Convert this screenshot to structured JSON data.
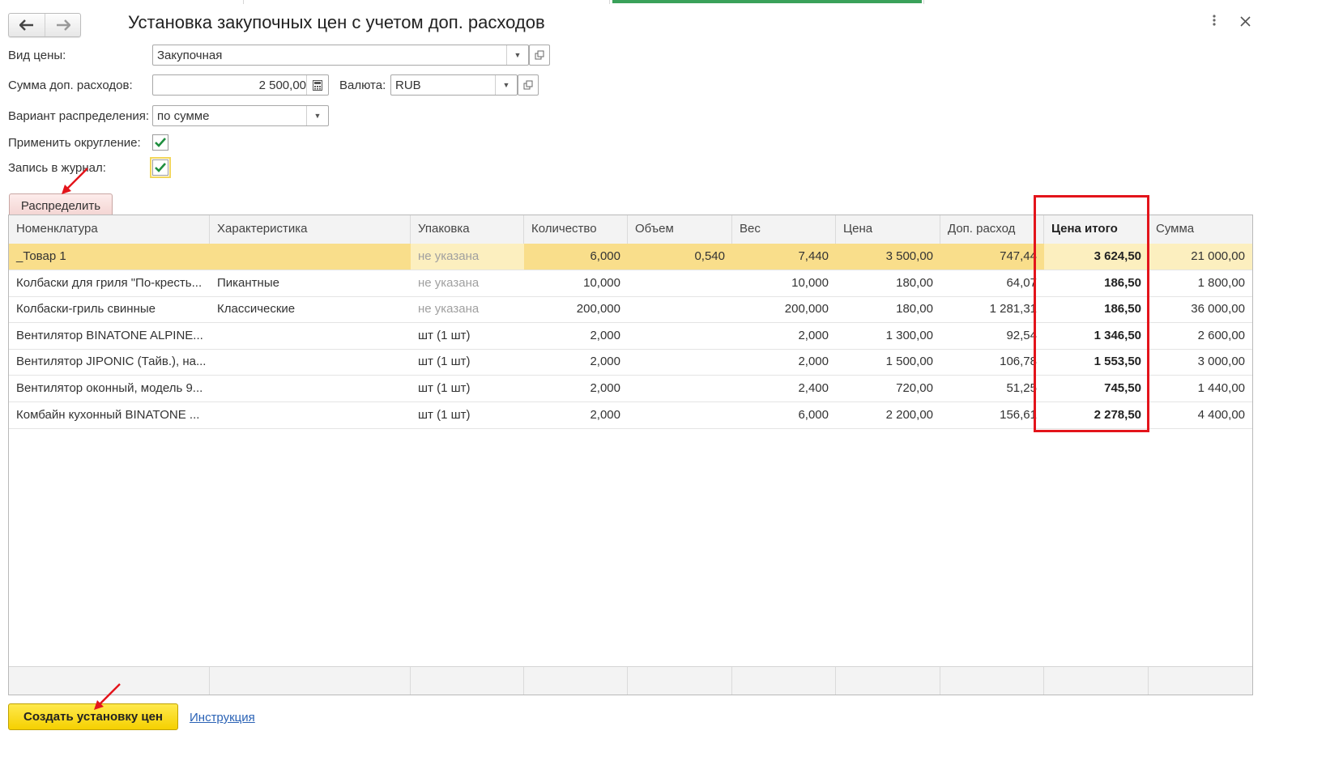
{
  "window": {
    "title": "Установка закупочных цен с учетом доп. расходов",
    "back_icon": "arrow-left",
    "forward_icon": "arrow-right",
    "more_icon": "vertical-dots",
    "close_icon": "close-x"
  },
  "form": {
    "price_type_label": "Вид цены:",
    "price_type_value": "Закупочная",
    "extra_costs_label": "Сумма доп. расходов:",
    "extra_costs_value": "2 500,00",
    "currency_label": "Валюта:",
    "currency_value": "RUB",
    "distribution_label": "Вариант распределения:",
    "distribution_value": "по сумме",
    "rounding_label": "Применить округление:",
    "rounding_checked": true,
    "journal_label": "Запись в журнал:",
    "journal_checked": true,
    "distribute_button": "Распределить"
  },
  "table": {
    "headers": [
      "Номенклатура",
      "Характеристика",
      "Упаковка",
      "Количество",
      "Объем",
      "Вес",
      "Цена",
      "Доп. расход",
      "Цена итого",
      "Сумма"
    ],
    "rows": [
      [
        "_Товар 1",
        "",
        "не указана",
        "6,000",
        "0,540",
        "7,440",
        "3 500,00",
        "747,44",
        "3 624,50",
        "21 000,00"
      ],
      [
        "Колбаски для гриля \"По-кресть...",
        "Пикантные",
        "не указана",
        "10,000",
        "",
        "10,000",
        "180,00",
        "64,07",
        "186,50",
        "1 800,00"
      ],
      [
        "Колбаски-гриль свинные",
        "Классические",
        "не указана",
        "200,000",
        "",
        "200,000",
        "180,00",
        "1 281,31",
        "186,50",
        "36 000,00"
      ],
      [
        "Вентилятор BINATONE ALPINE...",
        "",
        "шт (1 шт)",
        "2,000",
        "",
        "2,000",
        "1 300,00",
        "92,54",
        "1 346,50",
        "2 600,00"
      ],
      [
        "Вентилятор JIPONIC (Тайв.), на...",
        "",
        "шт (1 шт)",
        "2,000",
        "",
        "2,000",
        "1 500,00",
        "106,78",
        "1 553,50",
        "3 000,00"
      ],
      [
        "Вентилятор оконный, модель 9...",
        "",
        "шт (1 шт)",
        "2,000",
        "",
        "2,400",
        "720,00",
        "51,25",
        "745,50",
        "1 440,00"
      ],
      [
        "Комбайн кухонный BINATONE ...",
        "",
        "шт (1 шт)",
        "2,000",
        "",
        "6,000",
        "2 200,00",
        "156,61",
        "2 278,50",
        "4 400,00"
      ]
    ]
  },
  "footer": {
    "create_button": "Создать установку цен",
    "instruction_link": "Инструкция"
  },
  "colors": {
    "selected_row": "#fcefbf",
    "highlight_box": "#e3141b",
    "primary_button": "#f5d000",
    "link": "#2a62b5"
  }
}
